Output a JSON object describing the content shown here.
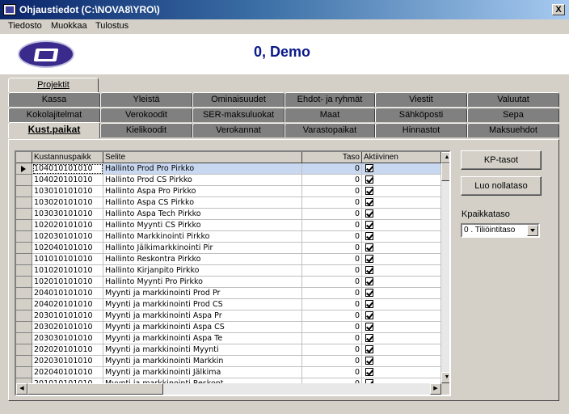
{
  "window": {
    "title": "Ohjaustiedot (C:\\NOVA8\\YRO\\)",
    "close_label": "X"
  },
  "menu": [
    {
      "label": "Tiedosto"
    },
    {
      "label": "Muokkaa"
    },
    {
      "label": "Tulostus"
    }
  ],
  "header": {
    "title": "0, Demo"
  },
  "tabs": {
    "row0": [
      {
        "label": "Projektit"
      }
    ],
    "row1": [
      {
        "label": "Kassa"
      },
      {
        "label": "Yleistä"
      },
      {
        "label": "Ominaisuudet"
      },
      {
        "label": "Ehdot- ja ryhmät"
      },
      {
        "label": "Viestit"
      },
      {
        "label": "Valuutat"
      }
    ],
    "row2": [
      {
        "label": "Kokolajitelmat"
      },
      {
        "label": "Verokoodit"
      },
      {
        "label": "SER-maksuluokat"
      },
      {
        "label": "Maat"
      },
      {
        "label": "Sähköposti"
      },
      {
        "label": "Sepa"
      }
    ],
    "row3": [
      {
        "label": "Kust.paikat"
      },
      {
        "label": "Kielikoodit"
      },
      {
        "label": "Verokannat"
      },
      {
        "label": "Varastopaikat"
      },
      {
        "label": "Hinnastot"
      },
      {
        "label": "Maksuehdot"
      }
    ],
    "active": "Kust.paikat"
  },
  "grid": {
    "columns": [
      "Kustannuspaikk",
      "Selite",
      "Taso",
      "Aktiivinen"
    ],
    "rows": [
      {
        "code": "104010101010",
        "desc": "Hallinto Prod Pro Pirkko",
        "level": "0",
        "active": true
      },
      {
        "code": "104020101010",
        "desc": "Hallinto Prod CS Pirkko",
        "level": "0",
        "active": true
      },
      {
        "code": "103010101010",
        "desc": "Hallinto Aspa Pro Pirkko",
        "level": "0",
        "active": true
      },
      {
        "code": "103020101010",
        "desc": "Hallinto Aspa CS Pirkko",
        "level": "0",
        "active": true
      },
      {
        "code": "103030101010",
        "desc": "Hallinto Aspa Tech Pirkko",
        "level": "0",
        "active": true
      },
      {
        "code": "102020101010",
        "desc": "Hallinto Myynti CS Pirkko",
        "level": "0",
        "active": true
      },
      {
        "code": "102030101010",
        "desc": "Hallinto Markkinointi Pirkko",
        "level": "0",
        "active": true
      },
      {
        "code": "102040101010",
        "desc": "Hallinto Jälkimarkkinointi Pir",
        "level": "0",
        "active": true
      },
      {
        "code": "101010101010",
        "desc": "Hallinto Reskontra Pirkko",
        "level": "0",
        "active": true
      },
      {
        "code": "101020101010",
        "desc": "Hallinto Kirjanpito Pirkko",
        "level": "0",
        "active": true
      },
      {
        "code": "102010101010",
        "desc": "Hallinto Myynti Pro Pirkko",
        "level": "0",
        "active": true
      },
      {
        "code": "204010101010",
        "desc": "Myynti ja markkinointi Prod Pr",
        "level": "0",
        "active": true
      },
      {
        "code": "204020101010",
        "desc": "Myynti ja markkinointi Prod CS",
        "level": "0",
        "active": true
      },
      {
        "code": "203010101010",
        "desc": "Myynti ja markkinointi Aspa Pr",
        "level": "0",
        "active": true
      },
      {
        "code": "203020101010",
        "desc": "Myynti ja markkinointi Aspa CS",
        "level": "0",
        "active": true
      },
      {
        "code": "203030101010",
        "desc": "Myynti ja markkinointi Aspa Te",
        "level": "0",
        "active": true
      },
      {
        "code": "202020101010",
        "desc": "Myynti ja markkinointi Myynti",
        "level": "0",
        "active": true
      },
      {
        "code": "202030101010",
        "desc": "Myynti ja markkinointi Markkin",
        "level": "0",
        "active": true
      },
      {
        "code": "202040101010",
        "desc": "Myynti ja markkinointi Jälkima",
        "level": "0",
        "active": true
      },
      {
        "code": "201010101010",
        "desc": "Myynti ja markkinointi Reskont",
        "level": "0",
        "active": true
      }
    ]
  },
  "side": {
    "kp_tasot_label": "KP-tasot",
    "luo_nollataso_label": "Luo nollataso",
    "kpaikkataso_label": "Kpaikkataso",
    "kpaikkataso_value": "0 . Tiliöintitaso"
  }
}
